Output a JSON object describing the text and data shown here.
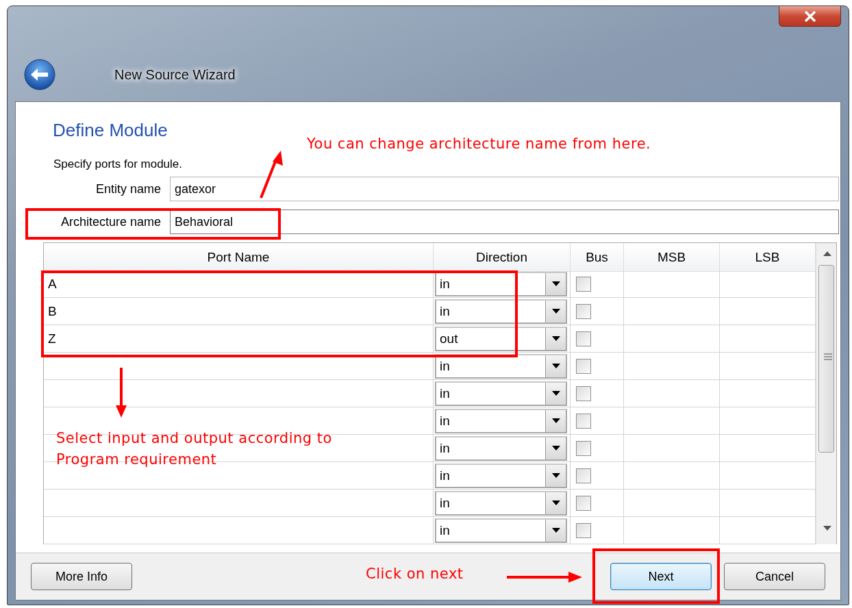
{
  "window": {
    "title": "New Source Wizard"
  },
  "page": {
    "heading": "Define Module",
    "instruction": "Specify ports for module."
  },
  "fields": [
    {
      "label": "Entity name",
      "value": "gatexor",
      "focused": false
    },
    {
      "label": "Architecture name",
      "value": "Behavioral",
      "focused": true
    }
  ],
  "table": {
    "columns": [
      "Port Name",
      "Direction",
      "Bus",
      "MSB",
      "LSB"
    ],
    "rows": [
      {
        "name": "A",
        "direction": "in",
        "bus": false
      },
      {
        "name": "B",
        "direction": "in",
        "bus": false
      },
      {
        "name": "Z",
        "direction": "out",
        "bus": false
      },
      {
        "direction": "in",
        "bus": false
      },
      {
        "direction": "in",
        "bus": false
      },
      {
        "direction": "in",
        "bus": false
      },
      {
        "direction": "in",
        "bus": false
      },
      {
        "direction": "in",
        "bus": false
      },
      {
        "direction": "in",
        "bus": false
      },
      {
        "direction": "in",
        "bus": false
      }
    ]
  },
  "buttons": [
    {
      "label": "More Info",
      "default": false
    },
    {
      "label": "Next",
      "default": true
    },
    {
      "label": "Cancel",
      "default": false
    }
  ],
  "annotations": {
    "architecture_hint": "You can change architecture name from here.",
    "ports_hint": [
      "Select input and output according to",
      "Program requirement"
    ],
    "next_hint": "Click on next"
  }
}
